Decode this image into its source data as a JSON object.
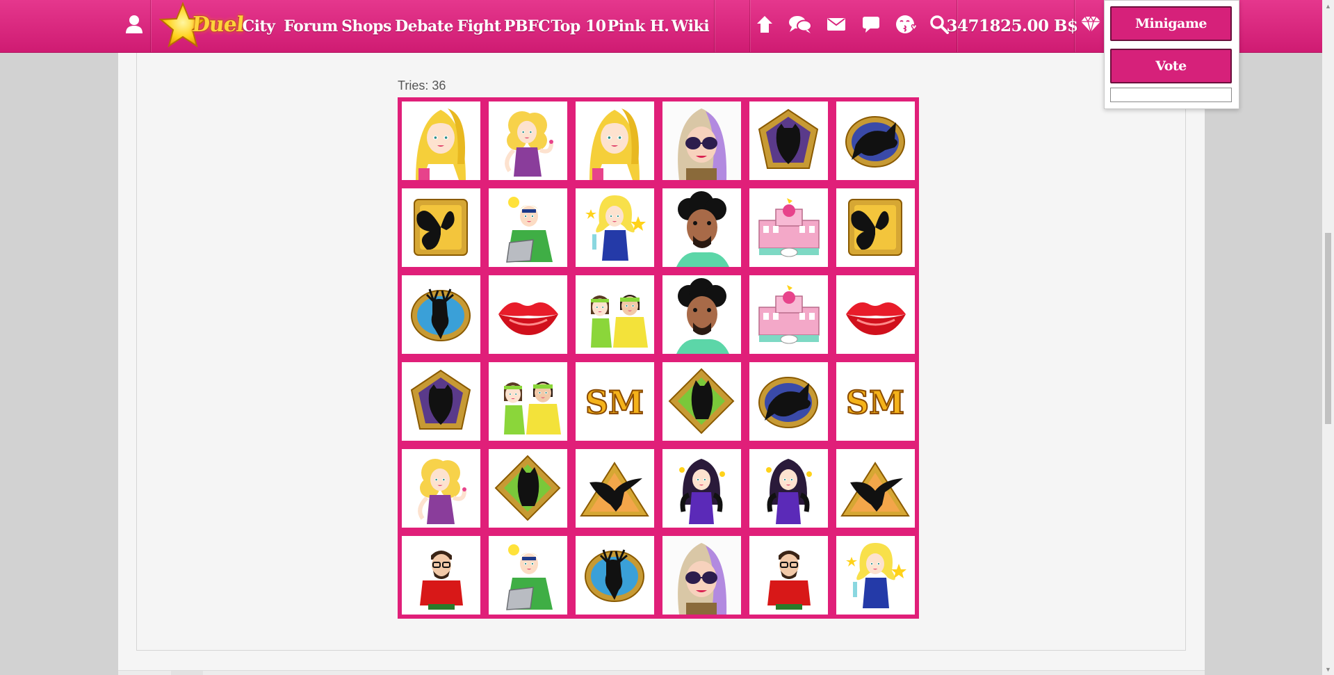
{
  "nav": {
    "logo_text": "Duel",
    "links": [
      "City",
      "Forum",
      "Shops",
      "Debate",
      "Fight",
      "PBFC",
      "Top 10",
      "Pink H.",
      "Wiki"
    ],
    "icons": [
      "user-icon",
      "home-icon",
      "chat-icon",
      "mail-icon",
      "speech-icon",
      "kiss-face-icon",
      "search-icon",
      "diamond-icon"
    ],
    "money": "3471825.00 B$"
  },
  "popup": {
    "minigame_label": "Minigame",
    "vote_label": "Vote",
    "input_value": ""
  },
  "game": {
    "tries_label": "Tries: 36",
    "board_color": "#e01f79",
    "columns": 6,
    "rows": 6,
    "cards": [
      [
        "blonde-ponytail-girl",
        "curly-blonde-girl",
        "blonde-ponytail-girl",
        "sunglasses-woman",
        "owl-silhouette-badge",
        "fish-silhouette-badge"
      ],
      [
        "butterfly-silhouette-badge",
        "laptop-guy",
        "party-blonde-girl",
        "curly-hair-man",
        "pink-palace",
        "butterfly-silhouette-badge"
      ],
      [
        "deer-silhouette-badge",
        "red-lips",
        "fitness-couple",
        "curly-hair-man",
        "pink-palace",
        "red-lips"
      ],
      [
        "owl-silhouette-badge",
        "fitness-couple",
        "sm-logo",
        "cat-silhouette-badge",
        "fish-silhouette-badge",
        "sm-logo"
      ],
      [
        "curly-blonde-girl",
        "cat-silhouette-badge",
        "eagle-silhouette-badge",
        "dark-hair-gloves-girl",
        "dark-hair-gloves-girl",
        "eagle-silhouette-badge"
      ],
      [
        "hipster-red-shirt-man",
        "laptop-guy",
        "deer-silhouette-badge",
        "sunglasses-woman",
        "hipster-red-shirt-man",
        "party-blonde-girl"
      ]
    ],
    "sm_text": "SM"
  }
}
